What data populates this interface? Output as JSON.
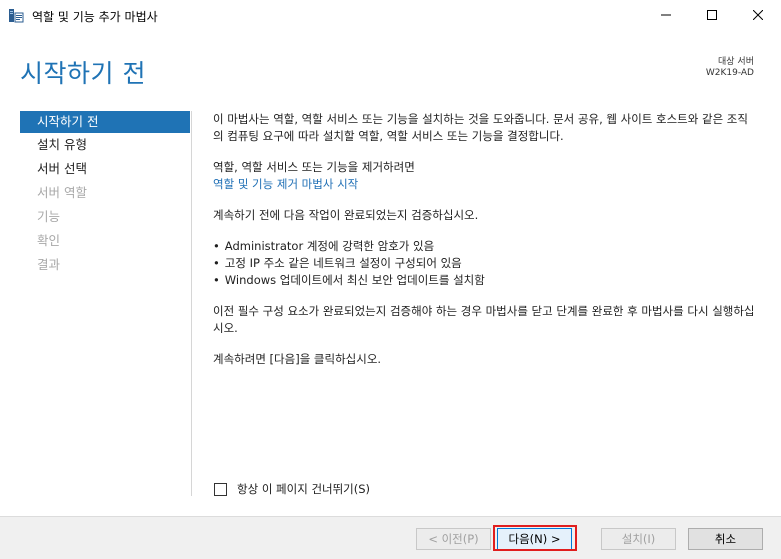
{
  "window": {
    "title": "역할 및 기능 추가 마법사",
    "icon": "server-manager-icon",
    "controls": [
      "minimize-icon",
      "maximize-icon",
      "close-icon"
    ]
  },
  "header": {
    "page_title": "시작하기 전",
    "destination_label": "대상 서버",
    "destination_value": "W2K19-AD"
  },
  "nav": {
    "items": [
      {
        "label": "시작하기 전",
        "state": "active"
      },
      {
        "label": "설치 유형",
        "state": "enabled"
      },
      {
        "label": "서버 선택",
        "state": "enabled"
      },
      {
        "label": "서버 역할",
        "state": "disabled"
      },
      {
        "label": "기능",
        "state": "disabled"
      },
      {
        "label": "확인",
        "state": "disabled"
      },
      {
        "label": "결과",
        "state": "disabled"
      }
    ]
  },
  "content": {
    "intro": "이 마법사는 역할, 역할 서비스 또는 기능을 설치하는 것을 도와줍니다. 문서 공유, 웹 사이트 호스트와 같은 조직의 컴퓨팅 요구에 따라 설치할 역할, 역할 서비스 또는 기능을 결정합니다.",
    "remove_text": "역할, 역할 서비스 또는 기능을 제거하려면",
    "remove_link": "역할 및 기능 제거 마법사 시작",
    "verify_text": "계속하기 전에 다음 작업이 완료되었는지 검증하십시오.",
    "bullets": [
      "Administrator 계정에 강력한 암호가 있음",
      "고정 IP 주소 같은 네트워크 설정이 구성되어 있음",
      "Windows 업데이트에서 최신 보안 업데이트를 설치함"
    ],
    "prereq_text": "이전 필수 구성 요소가 완료되었는지 검증해야 하는 경우 마법사를 닫고 단계를 완료한 후 마법사를 다시 실행하십시오.",
    "continue_text": "계속하려면 [다음]을 클릭하십시오."
  },
  "skip_checkbox": {
    "label": "항상 이 페이지 건너뛰기(S)",
    "checked": false
  },
  "footer": {
    "prev_label": "< 이전(P)",
    "next_label": "다음(N) >",
    "install_label": "설치(I)",
    "cancel_label": "취소"
  },
  "colors": {
    "accent": "#1f73b5",
    "highlight": "#e01e1e"
  }
}
